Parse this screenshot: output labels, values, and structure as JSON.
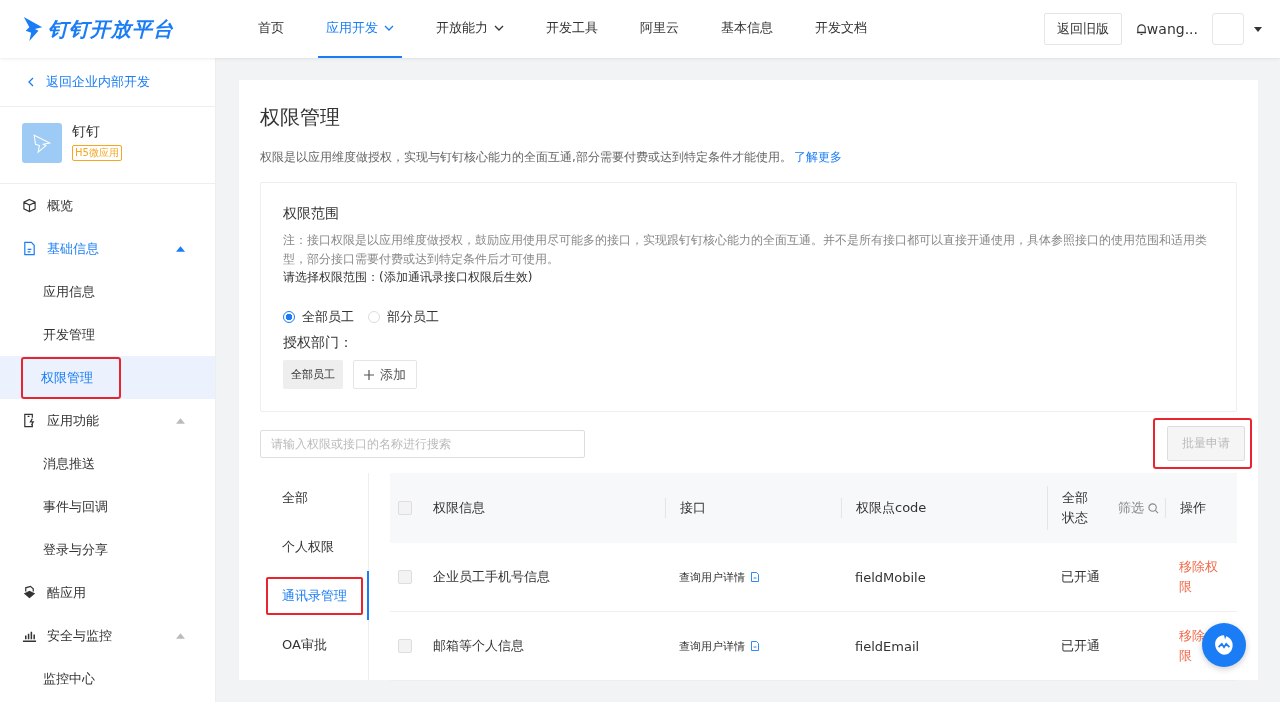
{
  "header": {
    "logo": "钉钉开放平台",
    "nav": [
      {
        "label": "首页",
        "selected": false,
        "dropdown": false
      },
      {
        "label": "应用开发",
        "selected": true,
        "dropdown": true
      },
      {
        "label": "开放能力",
        "selected": false,
        "dropdown": true
      },
      {
        "label": "开发工具",
        "selected": false,
        "dropdown": false
      },
      {
        "label": "阿里云",
        "selected": false,
        "dropdown": false
      },
      {
        "label": "基本信息",
        "selected": false,
        "dropdown": false
      },
      {
        "label": "开发文档",
        "selected": false,
        "dropdown": false
      }
    ],
    "old_version_button": "返回旧版",
    "user": "wang..."
  },
  "sidebar": {
    "back_link": "返回企业内部开发",
    "app": {
      "name": "钉钉",
      "tag": "H5微应用"
    },
    "nav": [
      {
        "kind": "item",
        "label": "概览"
      },
      {
        "kind": "group",
        "label": "基础信息",
        "active": true,
        "expanded": true,
        "children": [
          {
            "label": "应用信息",
            "selected": false,
            "highlighted": false
          },
          {
            "label": "开发管理",
            "selected": false,
            "highlighted": false
          },
          {
            "label": "权限管理",
            "selected": true,
            "highlighted": true
          }
        ]
      },
      {
        "kind": "group",
        "label": "应用功能",
        "active": false,
        "expanded": true,
        "children": [
          {
            "label": "消息推送",
            "selected": false,
            "highlighted": false
          },
          {
            "label": "事件与回调",
            "selected": false,
            "highlighted": false
          },
          {
            "label": "登录与分享",
            "selected": false,
            "highlighted": false
          }
        ]
      },
      {
        "kind": "item",
        "label": "酷应用"
      },
      {
        "kind": "group",
        "label": "安全与监控",
        "active": false,
        "expanded": true,
        "children": [
          {
            "label": "监控中心",
            "selected": false,
            "highlighted": false
          }
        ]
      }
    ]
  },
  "page": {
    "title": "权限管理",
    "description": "权限是以应用维度做授权，实现与钉钉核心能力的全面互通,部分需要付费或达到特定条件才能使用。",
    "learn_more": "了解更多",
    "scope": {
      "title": "权限范围",
      "note": "注：接口权限是以应用维度做授权，鼓励应用使用尽可能多的接口，实现跟钉钉核心能力的全面互通。并不是所有接口都可以直接开通使用，具体参照接口的使用范围和适用类型，部分接口需要付费或达到特定条件后才可使用。",
      "prompt": "请选择权限范围：(添加通讯录接口权限后生效)",
      "options": [
        {
          "label": "全部员工",
          "selected": true
        },
        {
          "label": "部分员工",
          "selected": false
        }
      ],
      "dept_label": "授权部门：",
      "dept_tags": [
        "全部员工"
      ],
      "add_button": "添加"
    },
    "search": {
      "placeholder": "请输入权限或接口的名称进行搜索"
    },
    "batch_button": {
      "label": "批量申请",
      "disabled": true,
      "highlighted": true
    },
    "categories": [
      {
        "label": "全部",
        "selected": false,
        "highlighted": false
      },
      {
        "label": "个人权限",
        "selected": false,
        "highlighted": false
      },
      {
        "label": "通讯录管理",
        "selected": true,
        "highlighted": true
      },
      {
        "label": "OA审批",
        "selected": false,
        "highlighted": false
      }
    ],
    "table": {
      "all_checked": false,
      "columns": [
        "权限信息",
        "接口",
        "权限点code",
        "全部状态",
        "操作"
      ],
      "filter": "筛选",
      "rows": [
        {
          "checked": false,
          "name": "企业员工手机号信息",
          "api": "查询用户详情",
          "code": "fieldMobile",
          "status": "已开通",
          "action_lines": [
            "移除权",
            "限"
          ]
        },
        {
          "checked": false,
          "name": "邮箱等个人信息",
          "api": "查询用户详情",
          "code": "fieldEmail",
          "status": "已开通",
          "action_lines": [
            "移除",
            "限"
          ]
        }
      ]
    }
  }
}
